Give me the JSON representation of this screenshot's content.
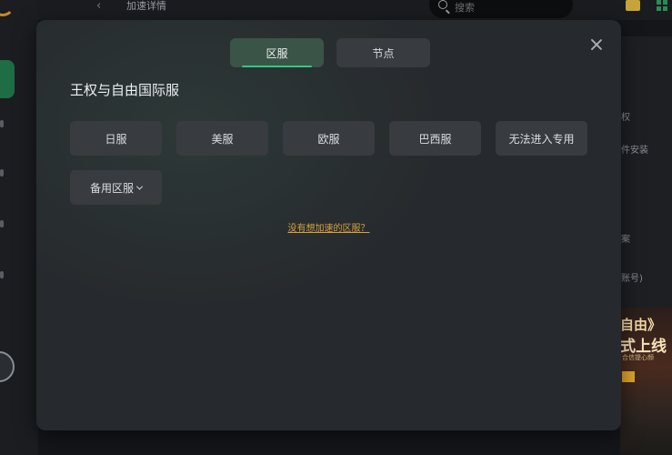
{
  "topbar": {
    "title": "加速详情",
    "search_placeholder": "搜索"
  },
  "side_snippets": [
    "权",
    "件安装",
    "案",
    "账号)"
  ],
  "promo": {
    "line1": "自由》",
    "line2": "式上线",
    "line3": "合信提心频"
  },
  "modal": {
    "tabs": [
      {
        "label": "区服",
        "active": true
      },
      {
        "label": "节点",
        "active": false
      }
    ],
    "game_title": "王权与自由国际服",
    "servers": [
      "日服",
      "美服",
      "欧服",
      "巴西服",
      "无法进入专用"
    ],
    "backup_label": "备用区服",
    "help_link": "没有想加速的区服？"
  },
  "colors": {
    "accent_green": "#2fca7d",
    "link_orange": "#d7a13a",
    "modal_bg": "#26292d",
    "button_bg": "#383b40"
  }
}
